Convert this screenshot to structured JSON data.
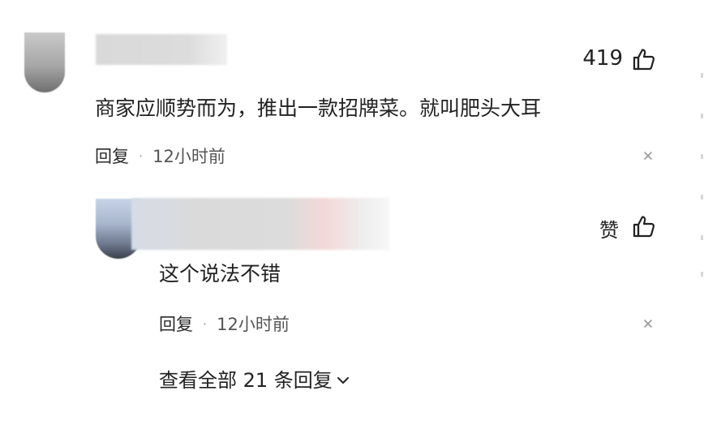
{
  "comment": {
    "like_count": "419",
    "text": "商家应顺势而为，推出一款招牌菜。就叫肥头大耳",
    "reply_label": "回复",
    "separator": "·",
    "time": "12小时前"
  },
  "reply": {
    "like_label": "赞",
    "text": "这个说法不错",
    "reply_label": "回复",
    "separator": "·",
    "time": "12小时前"
  },
  "view_all": {
    "label": "查看全部 21 条回复"
  },
  "icons": {
    "like": "thumbs-up-icon",
    "close": "close-icon",
    "expand": "chevron-down-icon"
  }
}
